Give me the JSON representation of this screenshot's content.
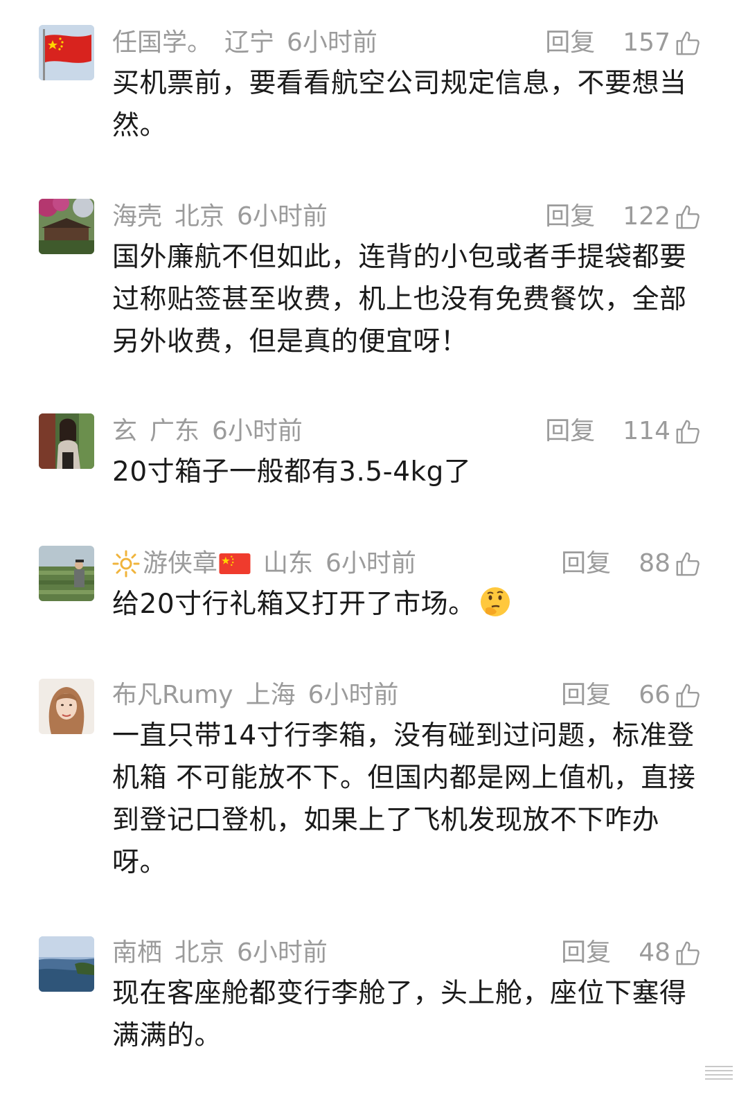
{
  "comments": [
    {
      "nickname": "任国学。",
      "location": "辽宁",
      "time": "6小时前",
      "reply_label": "回复",
      "likes": "157",
      "text": "买机票前，要看看航空公司规定信息，不要想当然。",
      "avatar": "china-flag-avatar"
    },
    {
      "nickname": "海壳",
      "location": "北京",
      "time": "6小时前",
      "reply_label": "回复",
      "likes": "122",
      "text": "国外廉航不但如此，连背的小包或者手提袋都要过称贴签甚至收费，机上也没有免费餐饮，全部另外收费，但是真的便宜呀！",
      "avatar": "pink-blossom-house-avatar"
    },
    {
      "nickname": "玄",
      "location": "广东",
      "time": "6小时前",
      "reply_label": "回复",
      "likes": "114",
      "text": "20寸箱子一般都有3.5-4kg了",
      "avatar": "woman-in-doorway-avatar"
    },
    {
      "nickname": "游侠章",
      "location": "山东",
      "time": "6小时前",
      "reply_label": "回复",
      "likes": "88",
      "text": "给20寸行礼箱又打开了市场。",
      "avatar": "man-in-field-avatar",
      "emoji": "thinking-face-emoji"
    },
    {
      "nickname": "布凡Rumy",
      "location": "上海",
      "time": "6小时前",
      "reply_label": "回复",
      "likes": "66",
      "text": "一直只带14寸行李箱，没有碰到过问题，标准登机箱 不可能放不下。但国内都是网上值机，直接到登记口登机，如果上了飞机发现放不下咋办呀。",
      "avatar": "woman-portrait-avatar"
    },
    {
      "nickname": "南栖",
      "location": "北京",
      "time": "6小时前",
      "reply_label": "回复",
      "likes": "48",
      "text": "现在客座舱都变行李舱了，头上舱，座位下塞得满满的。",
      "avatar": "coast-landscape-avatar"
    }
  ],
  "colors": {
    "meta_text": "#9b9b9b",
    "body_text": "#1a1a1a",
    "background": "#ffffff"
  }
}
